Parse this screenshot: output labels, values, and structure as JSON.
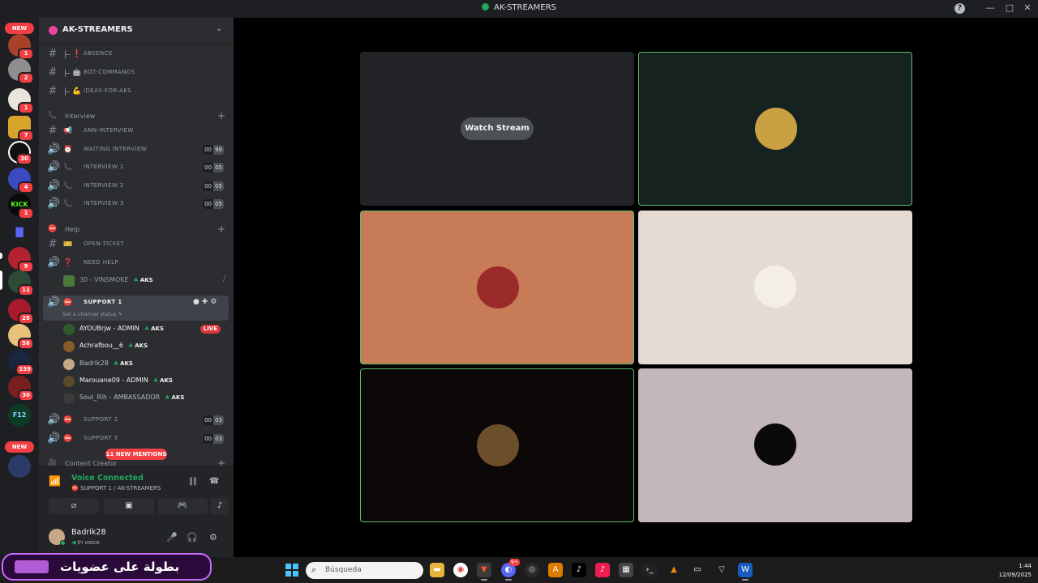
{
  "window": {
    "title": "AK-STREAMERS"
  },
  "rail": {
    "new_label": "NEW",
    "badges": [
      "1",
      "2",
      "1",
      "7",
      "30",
      "4",
      "1",
      "9",
      "11",
      "28",
      "56",
      "159",
      "30"
    ]
  },
  "server": {
    "name": "AK-STREAMERS"
  },
  "channels": {
    "text_top": [
      {
        "emoji": "❗",
        "name": "ABSENCE"
      },
      {
        "emoji": "🤖",
        "name": "BOT-COMMANDS"
      },
      {
        "emoji": "💪",
        "name": "IDEAS-FOR-AKS"
      }
    ],
    "interview_category": "Interview",
    "interview": [
      {
        "emoji": "📢",
        "name": "ANN-INTERVIEW"
      },
      {
        "emoji": "⏰",
        "name": "WAITING INTERVIEW",
        "c1": "00",
        "c2": "99"
      },
      {
        "emoji": "📞",
        "name": "INTERVIEW 1",
        "c1": "00",
        "c2": "05"
      },
      {
        "emoji": "📞",
        "name": "INTERVIEW 2",
        "c1": "00",
        "c2": "05"
      },
      {
        "emoji": "📞",
        "name": "INTERVIEW 3",
        "c1": "00",
        "c2": "05"
      }
    ],
    "help_category": "Help",
    "help": [
      {
        "emoji": "🎫",
        "name": "OPEN-TICKET"
      },
      {
        "emoji": "❓",
        "name": "NEED HELP"
      }
    ],
    "need_help_user": {
      "name": "30 - VINSMOKE",
      "tag": "AKS"
    },
    "support1": {
      "name": "SUPPORT 1",
      "status": "Set a channel status"
    },
    "support1_users": [
      {
        "name": "AYOUBrjw - ADMIN",
        "tag": "AKS",
        "live": "LIVE"
      },
      {
        "name": "Achrafbou__6",
        "tag": "AKS"
      },
      {
        "name": "Badrik28",
        "tag": "AKS"
      },
      {
        "name": "Marouane09 - ADMIN",
        "tag": "AKS"
      },
      {
        "name": "Soul_Rih - AMBASSADOR",
        "tag": "AKS"
      }
    ],
    "support_more": [
      {
        "name": "SUPPORT 2",
        "c1": "00",
        "c2": "03"
      },
      {
        "name": "SUPPORT 3",
        "c1": "00",
        "c2": "03"
      }
    ],
    "content_category": "Content Creator",
    "mentions": "11 NEW MENTIONS"
  },
  "voice": {
    "title": "Voice Connected",
    "sub": "SUPPORT 1 / AK-STREAMERS"
  },
  "user": {
    "name": "Badrik28",
    "status": "In voice"
  },
  "stage": {
    "watch_label": "Watch Stream",
    "tiles": [
      {
        "bg": "#222326",
        "avatar": null,
        "speaking": false
      },
      {
        "bg": "#152220",
        "avatar": "#c9a042",
        "speaking": true
      },
      {
        "bg": "#c77b57",
        "avatar": "#9b2a2a",
        "speaking": true
      },
      {
        "bg": "#e6dbd3",
        "avatar": "#f3efe8",
        "speaking": false
      },
      {
        "bg": "#0b0807",
        "avatar": "#6b4e2a",
        "speaking": true
      },
      {
        "bg": "#c3b7ba",
        "avatar": "#0a0a0a",
        "speaking": false
      }
    ]
  },
  "taskbar": {
    "banner_text": "بطولة على عضويات",
    "search_placeholder": "Búsqueda",
    "time": "1:44",
    "date": "12/09/2025",
    "discord_badge": "9+"
  }
}
